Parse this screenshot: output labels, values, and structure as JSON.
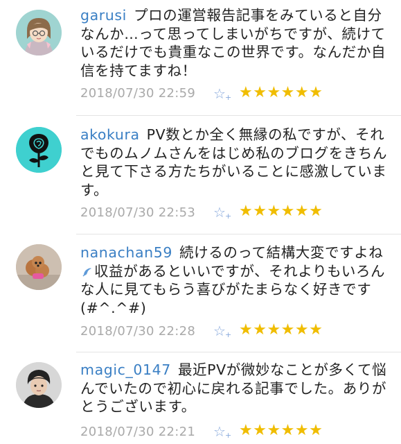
{
  "comments": [
    {
      "username": "garusi",
      "text": "プロの運営報告記事をみていると自分なんか…って思ってしまいがちですが、続けているだけでも貴重なこの世界です。なんだか自信を持てますね！",
      "timestamp": "2018/07/30 22:59",
      "add_star_icon": "add-star-icon",
      "stars": "★★★★★★",
      "star_count": 6
    },
    {
      "username": "akokura",
      "text": "PV数とか全く無縁の私ですが、それでものムノムさんをはじめ私のブログをきちんと見て下さる方たちがいることに感激しています。",
      "timestamp": "2018/07/30 22:53",
      "add_star_icon": "add-star-icon",
      "stars": "★★★★★★",
      "star_count": 6
    },
    {
      "username": "nanachan59",
      "text_a": "続けるのって結構大変ですよね",
      "emoji_icon": "droplet-emoji-icon",
      "text_b": "収益があるといいですが、それよりもいろんな人に見てもらう喜びがたまらなく好きです(#^.^#)",
      "timestamp": "2018/07/30 22:28",
      "add_star_icon": "add-star-icon",
      "stars": "★★★★★★",
      "star_count": 6
    },
    {
      "username": "magic_0147",
      "text": "最近PVが微妙なことが多くて悩んでいたので初心に戻れる記事でした。ありがとうございます。",
      "timestamp": "2018/07/30 22:21",
      "add_star_icon": "add-star-icon",
      "stars": "★★★★★★",
      "star_count": 6
    }
  ],
  "colors": {
    "username": "#3a7fc4",
    "star": "#f0bd00",
    "timestamp": "#a9a9a9",
    "add_star": "#88a9dc"
  }
}
